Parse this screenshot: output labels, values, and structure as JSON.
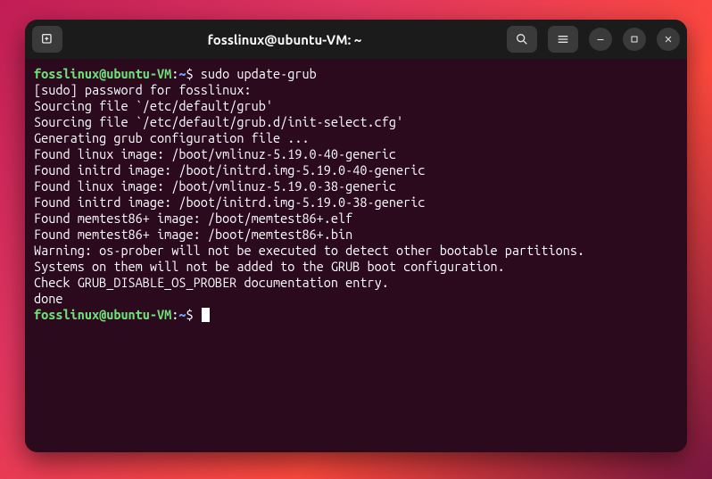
{
  "window": {
    "title": "fosslinux@ubuntu-VM: ~"
  },
  "prompt": {
    "user_host": "fosslinux@ubuntu-VM",
    "colon": ":",
    "path": "~",
    "dollar": "$"
  },
  "commands": {
    "cmd1": "sudo update-grub"
  },
  "output": {
    "l1": "[sudo] password for fosslinux:",
    "l2": "Sourcing file `/etc/default/grub'",
    "l3": "Sourcing file `/etc/default/grub.d/init-select.cfg'",
    "l4": "Generating grub configuration file ...",
    "l5": "Found linux image: /boot/vmlinuz-5.19.0-40-generic",
    "l6": "Found initrd image: /boot/initrd.img-5.19.0-40-generic",
    "l7": "Found linux image: /boot/vmlinuz-5.19.0-38-generic",
    "l8": "Found initrd image: /boot/initrd.img-5.19.0-38-generic",
    "l9": "Found memtest86+ image: /boot/memtest86+.elf",
    "l10": "Found memtest86+ image: /boot/memtest86+.bin",
    "l11": "Warning: os-prober will not be executed to detect other bootable partitions.",
    "l12": "Systems on them will not be added to the GRUB boot configuration.",
    "l13": "Check GRUB_DISABLE_OS_PROBER documentation entry.",
    "l14": "done"
  }
}
